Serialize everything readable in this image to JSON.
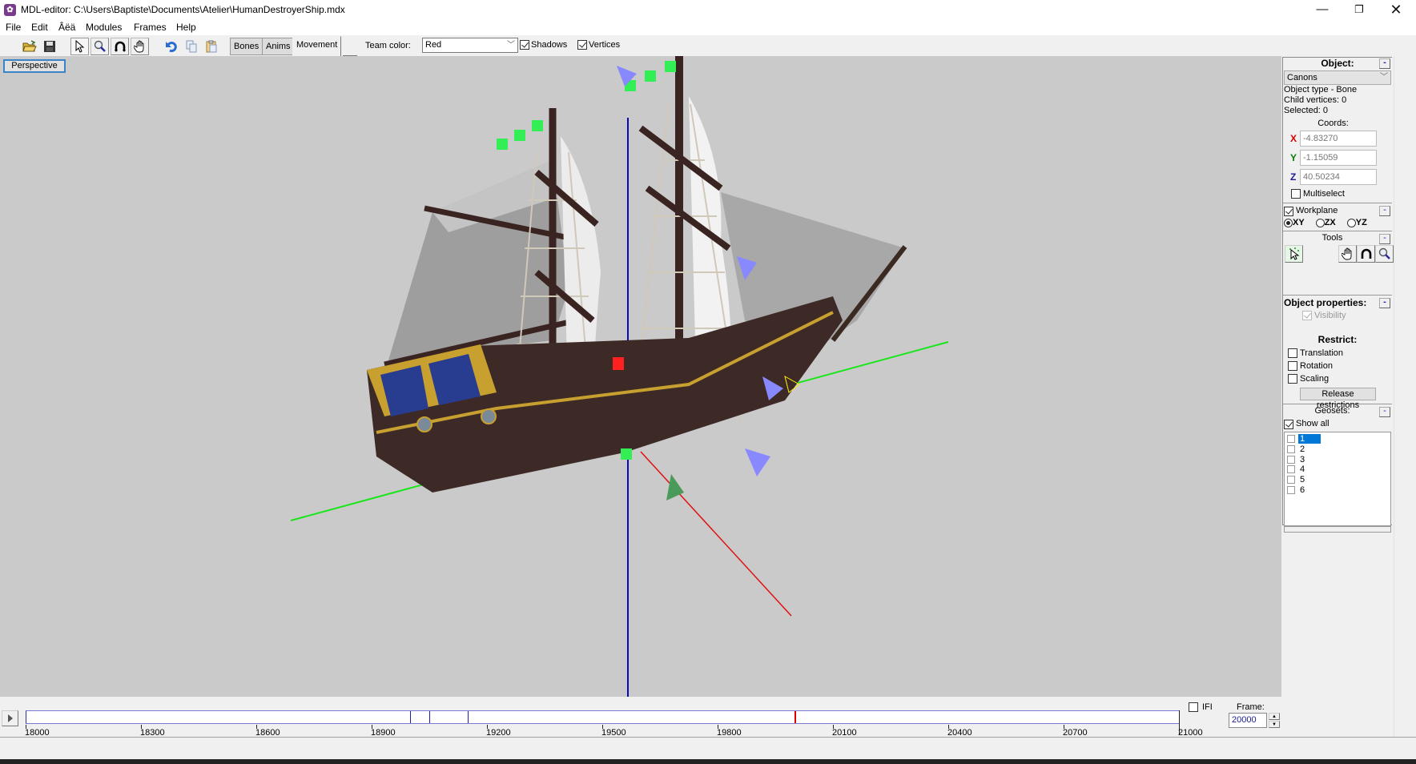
{
  "window": {
    "app_icon": "mdl-editor-icon",
    "title": "MDL-editor: C:\\Users\\Baptiste\\Documents\\Atelier\\HumanDestroyerShip.mdx",
    "minimize": "—",
    "maximize": "❐",
    "close": "✕"
  },
  "menu": [
    "File",
    "Edit",
    "Âëä",
    "Modules",
    "Frames",
    "Help"
  ],
  "toolbar": {
    "icons": [
      "open-folder-icon",
      "save-icon",
      "select-pointer-icon",
      "zoom-icon",
      "rotate-icon",
      "pan-hand-icon",
      "undo-icon",
      "copy-icon",
      "paste-icon"
    ],
    "tabs": [
      "Bones",
      "Anims",
      "Movement"
    ],
    "active_tab": "Movement",
    "team_color_label": "Team color:",
    "team_color_value": "Red",
    "shadows_label": "Shadows",
    "shadows_checked": true,
    "vertices_label": "Vertices",
    "vertices_checked": true
  },
  "viewport": {
    "view_button": "Perspective",
    "background": "#cacaca",
    "axis_colors": {
      "x": "#ff0000",
      "y": "#00e000",
      "z": "#0000c0"
    }
  },
  "panel": {
    "object_header": "Object:",
    "object_selected": "Canons",
    "object_type": "Object type - Bone",
    "child_vertices": "Child vertices: 0",
    "selected": "Selected: 0",
    "coords_label": "Coords:",
    "coords": {
      "x_label": "X",
      "x": "-4.83270",
      "y_label": "Y",
      "y": "-1.15059",
      "z_label": "Z",
      "z": "40.50234"
    },
    "multiselect_label": "Multiselect",
    "multiselect_checked": false,
    "workplane_label": "Workplane",
    "workplane_checked": true,
    "planes": [
      "XY",
      "ZX",
      "YZ"
    ],
    "plane_selected": "XY",
    "tools_header": "Tools",
    "tools": [
      "select-vertex-icon",
      "pan-hand-icon",
      "rotate-icon",
      "zoom-icon"
    ],
    "object_properties_header": "Object properties:",
    "visibility_label": "Visibility",
    "visibility_checked": true,
    "restrict_header": "Restrict:",
    "restrict": [
      {
        "label": "Translation",
        "checked": false
      },
      {
        "label": "Rotation",
        "checked": false
      },
      {
        "label": "Scaling",
        "checked": false
      }
    ],
    "release_button": "Release restrictions",
    "geosets_header": "Geosets:",
    "show_all_label": "Show all",
    "show_all_checked": true,
    "geosets": [
      "1",
      "2",
      "3",
      "4",
      "5",
      "6"
    ],
    "geoset_selected": "1",
    "minimize_glyph": "-"
  },
  "timeline": {
    "play_icon": "play-icon",
    "range": [
      18000,
      21000
    ],
    "tick_labels": [
      "18000",
      "18300",
      "18600",
      "18900",
      "19200",
      "19500",
      "19800",
      "20100",
      "20400",
      "20700",
      "21000"
    ],
    "keyframes": [
      19000,
      19050,
      19150
    ],
    "keyframe_color": "#2020a0",
    "current_frame": 20000,
    "current_color": "#e00000",
    "ifi_label": "IFI",
    "ifi_checked": false,
    "frame_label": "Frame:",
    "frame_value": "20000"
  }
}
